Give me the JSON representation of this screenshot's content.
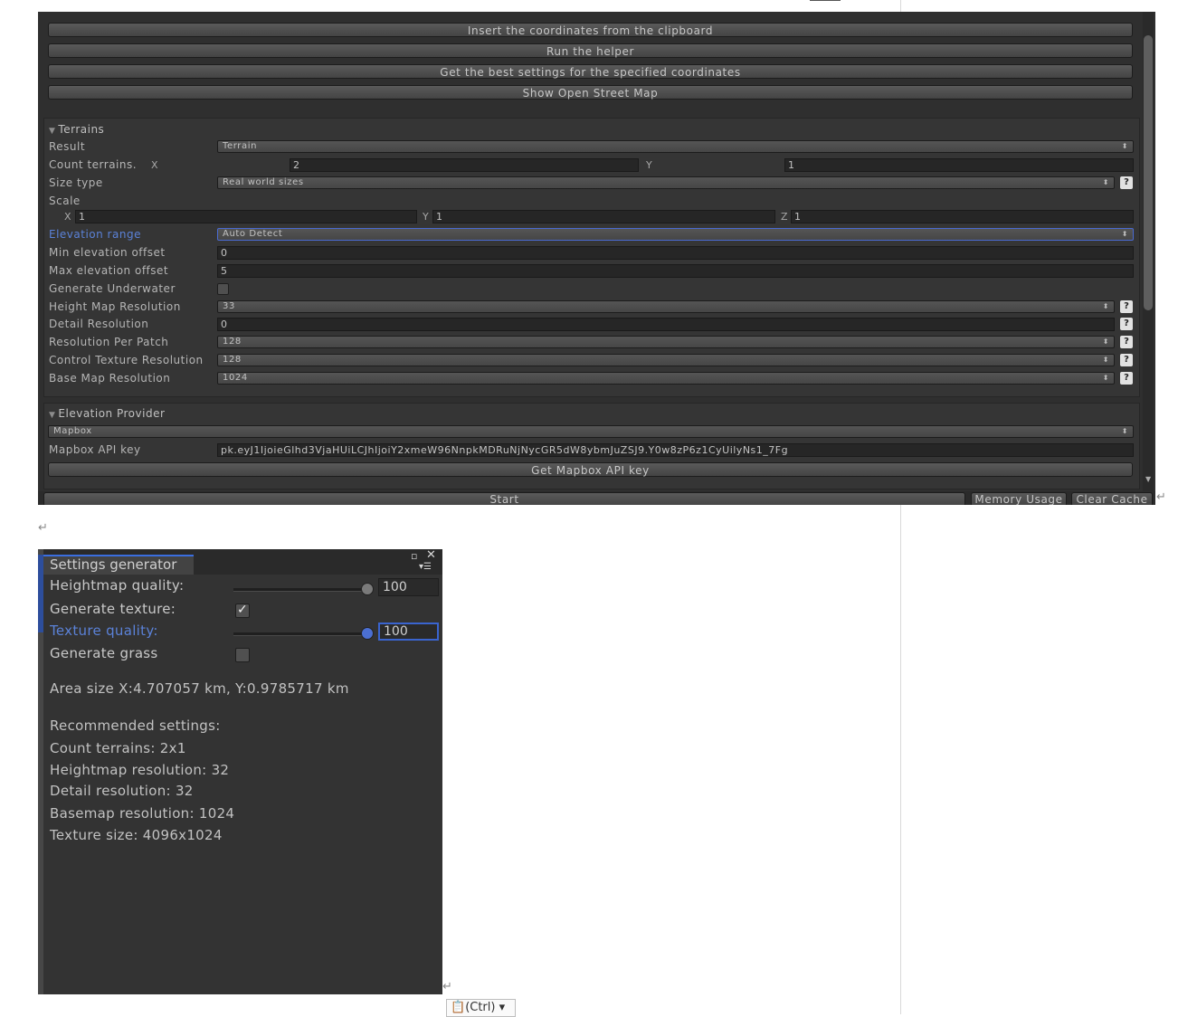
{
  "top_panel": {
    "buttons": [
      "Insert the coordinates from the clipboard",
      "Run the helper",
      "Get the best settings for the specified coordinates",
      "Show Open Street Map"
    ],
    "terrains": {
      "header": "Terrains",
      "result": {
        "label": "Result",
        "value": "Terrain"
      },
      "count": {
        "label": "Count terrains.",
        "x_label": "X",
        "x": "2",
        "y_label": "Y",
        "y": "1"
      },
      "size_type": {
        "label": "Size type",
        "value": "Real world sizes"
      },
      "scale": {
        "label": "Scale",
        "x_label": "X",
        "x": "1",
        "y_label": "Y",
        "y": "1",
        "z_label": "Z",
        "z": "1"
      },
      "elevation_range": {
        "label": "Elevation range",
        "value": "Auto Detect"
      },
      "min_elevation": {
        "label": "Min elevation offset",
        "value": "0"
      },
      "max_elevation": {
        "label": "Max elevation offset",
        "value": "5"
      },
      "generate_underwater": {
        "label": "Generate Underwater"
      },
      "height_map_res": {
        "label": "Height Map Resolution",
        "value": "33"
      },
      "detail_res": {
        "label": "Detail Resolution",
        "value": "0"
      },
      "res_per_patch": {
        "label": "Resolution Per Patch",
        "value": "128"
      },
      "control_tex_res": {
        "label": "Control Texture Resolution",
        "value": "128"
      },
      "base_map_res": {
        "label": "Base Map Resolution",
        "value": "1024"
      },
      "help_glyph": "?"
    },
    "elevation_provider": {
      "header": "Elevation Provider",
      "provider": "Mapbox",
      "api_key_label": "Mapbox API key",
      "api_key": "pk.eyJ1IjoieGlhd3VjaHUiLCJhIjoiY2xmeW96NnpkMDRuNjNycGR5dW8ybmJuZSJ9.Y0w8zP6z1CyUilyNs1_7Fg",
      "get_key_button": "Get Mapbox API key"
    },
    "footer": {
      "start": "Start",
      "memory": "Memory Usage",
      "clear": "Clear Cache"
    }
  },
  "settings_window": {
    "tab_title": "Settings generator",
    "heightmap_quality": {
      "label": "Heightmap quality:",
      "value": "100",
      "fraction": 1.0
    },
    "generate_texture": {
      "label": "Generate texture:",
      "checked": true
    },
    "texture_quality": {
      "label": "Texture quality:",
      "value": "100",
      "fraction": 1.0
    },
    "generate_grass": {
      "label": "Generate grass",
      "checked": false
    },
    "area_size": "Area size X:4.707057 km, Y:0.9785717 km",
    "recommended_header": "Recommended settings:",
    "recommended": [
      "Count terrains: 2x1",
      "Heightmap resolution: 32",
      "Detail resolution: 32",
      "Basemap resolution: 1024",
      "Texture size: 4096x1024"
    ]
  },
  "paste_badge": "(Ctrl)",
  "return_mark": "↵"
}
